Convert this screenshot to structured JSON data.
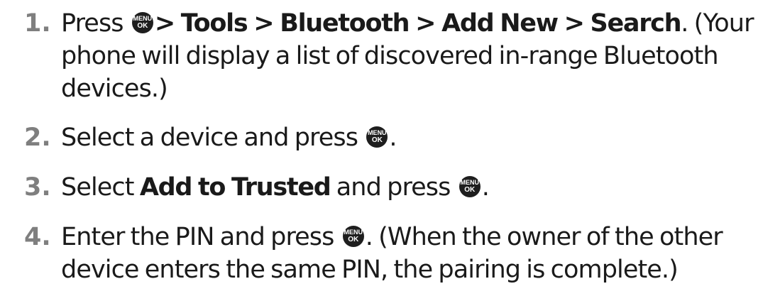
{
  "key_icon": {
    "name": "menu-ok-key-icon",
    "top": "MENU",
    "bottom": "OK",
    "color": "#1e1e1e"
  },
  "steps": [
    {
      "number": "1.",
      "pre": "Press ",
      "path": "> Tools > Bluetooth > Add New > Search",
      "post": ". (Your phone will display a list of discovered in-range Bluetooth devices.)"
    },
    {
      "number": "2.",
      "pre": "Select a device and press ",
      "post": "."
    },
    {
      "number": "3.",
      "pre": "Select ",
      "bold": "Add to Trusted",
      "mid": " and press ",
      "post": "."
    },
    {
      "number": "4.",
      "pre": "Enter the PIN and press ",
      "post": ". (When the owner of the other device enters the same PIN, the pairing is complete.)"
    }
  ],
  "colors": {
    "step_number": "#7f7f7f",
    "text": "#1a1a1a"
  }
}
